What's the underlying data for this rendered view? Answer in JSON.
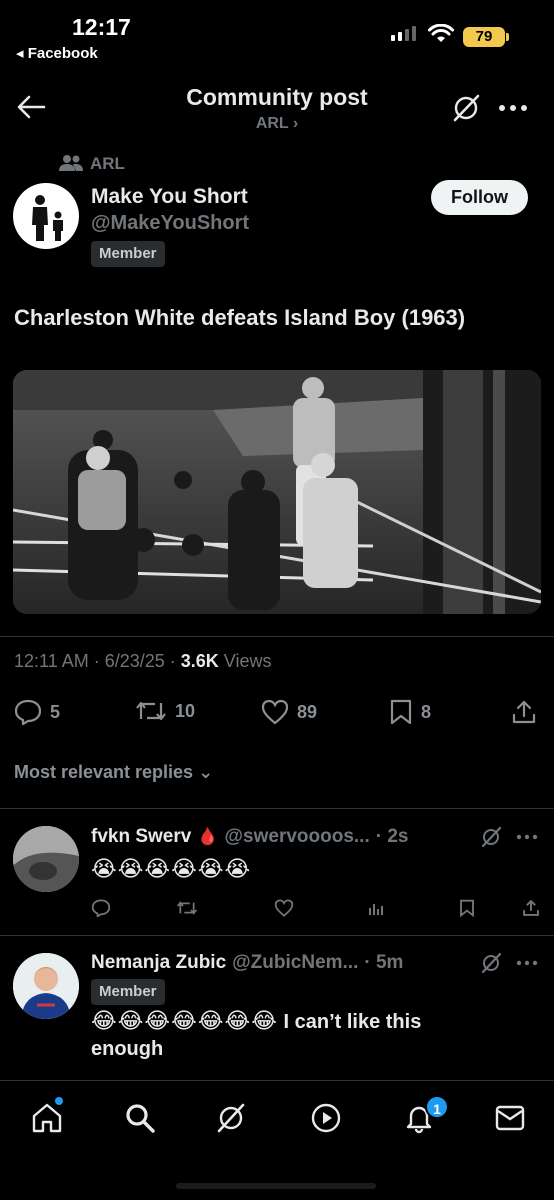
{
  "status_bar": {
    "time": "12:17",
    "back_app": "◂ Facebook",
    "battery": "79"
  },
  "header": {
    "title": "Community post",
    "community": "ARL ›"
  },
  "community_tag": "ARL",
  "author": {
    "name": "Make You Short",
    "handle": "@MakeYouShort",
    "badge": "Member"
  },
  "follow_label": "Follow",
  "post": {
    "text": "Charleston White defeats Island Boy (1963)",
    "time": "12:11 AM · 6/23/25 · ",
    "views_count": "3.6K",
    "views_label": " Views"
  },
  "actions": {
    "replies": "5",
    "reposts": "10",
    "likes": "89",
    "bookmarks": "8"
  },
  "sort_label": "Most relevant replies",
  "replies": [
    {
      "name": "fvkn Swerv",
      "emoji_after_name": "🩸",
      "handle": "@swervoooos...",
      "time": "· 2s",
      "text": "😭😭😭😭😭😭"
    },
    {
      "name": "Nemanja Zubic",
      "handle": "@ZubicNem...",
      "time": "· 5m",
      "badge": "Member",
      "emoji": "😂😂😂😂😂😂😂",
      "text": " I can’t like this",
      "text2": "enough"
    }
  ],
  "nav": {
    "notification_count": "1"
  },
  "colors": {
    "accent": "#1d9bf0",
    "battery": "#f2c94c",
    "background": "#000000"
  }
}
